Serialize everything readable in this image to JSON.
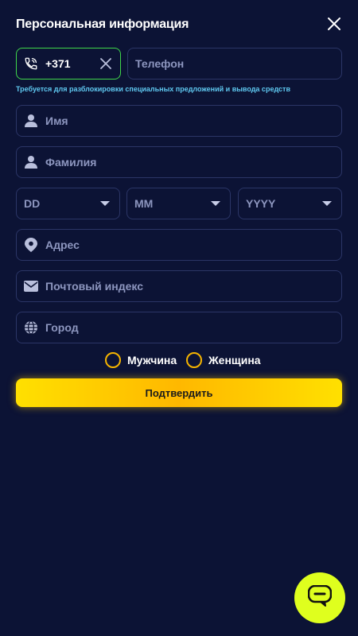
{
  "header": {
    "title": "Персональная информация"
  },
  "phone": {
    "code": "+371",
    "placeholder": "Телефон",
    "hint": "Требуется для разблокировки специальных предложений и вывода средств"
  },
  "fields": {
    "first_name": "Имя",
    "last_name": "Фамилия",
    "day": "DD",
    "month": "MM",
    "year": "YYYY",
    "address": "Адрес",
    "postal_code": "Почтовый индекс",
    "city": "Город"
  },
  "gender": {
    "male": "Мужчина",
    "female": "Женщина"
  },
  "submit_label": "Подтвердить",
  "colors": {
    "background": "#0c1335",
    "accent": "#ffc800",
    "active_border": "#3fd64a",
    "hint": "#5fc8f0",
    "chat": "#dfff1e"
  },
  "icons": [
    "close-icon",
    "phone-icon",
    "clear-icon",
    "user-icon",
    "chevron-down-icon",
    "location-pin-icon",
    "mail-icon",
    "globe-icon",
    "chat-icon"
  ]
}
